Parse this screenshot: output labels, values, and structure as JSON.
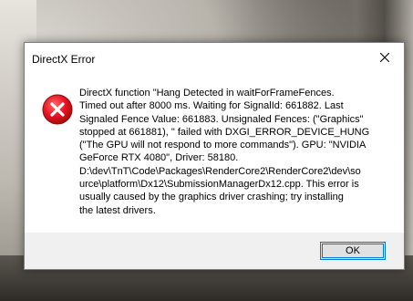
{
  "window": {
    "title": "DirectX Error",
    "close_icon": "close-icon"
  },
  "dialog": {
    "icon": "error-icon",
    "icon_color": "#e81123",
    "message": "DirectX function \"Hang Detected in waitForFrameFences.\nTimed out after 8000 ms. Waiting for SignalId: 661882. Last\nSignaled Fence Value: 661883. Unsignaled Fences: (\"Graphics\"\nstopped at 661881), \" failed with DXGI_ERROR_DEVICE_HUNG\n(\"The GPU will not respond to more commands\"). GPU: \"NVIDIA\nGeForce RTX 4080\", Driver: 58180.\nD:\\dev\\TnT\\Code\\Packages\\RenderCore2\\RenderCore2\\dev\\so\nurce\\platform\\Dx12\\SubmissionManagerDx12.cpp. This error is\nusually caused by the graphics driver crashing; try installing\nthe latest drivers."
  },
  "footer": {
    "ok_label": "OK",
    "accent": "#0078d7"
  }
}
